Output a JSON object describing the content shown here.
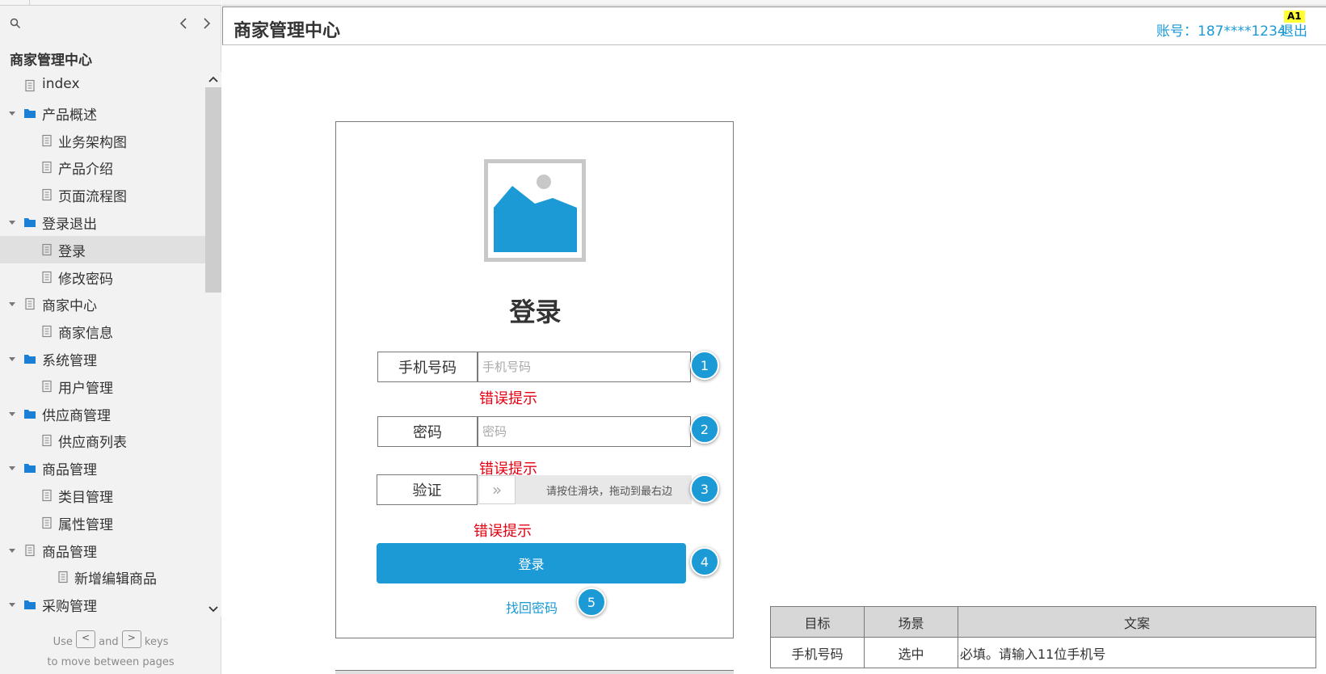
{
  "sidebar": {
    "title": "商家管理中心",
    "items": [
      {
        "label": "index",
        "level": 1,
        "type": "page",
        "caret": false
      },
      {
        "label": "产品概述",
        "level": 0,
        "type": "folder",
        "caret": true
      },
      {
        "label": "业务架构图",
        "level": 2,
        "type": "page",
        "caret": false
      },
      {
        "label": "产品介绍",
        "level": 2,
        "type": "page",
        "caret": false
      },
      {
        "label": "页面流程图",
        "level": 2,
        "type": "page",
        "caret": false
      },
      {
        "label": "登录退出",
        "level": 0,
        "type": "folder",
        "caret": true
      },
      {
        "label": "登录",
        "level": 2,
        "type": "page",
        "caret": false,
        "selected": true
      },
      {
        "label": "修改密码",
        "level": 2,
        "type": "page",
        "caret": false
      },
      {
        "label": "商家中心",
        "level": 0,
        "type": "page",
        "caret": true
      },
      {
        "label": "商家信息",
        "level": 2,
        "type": "page",
        "caret": false
      },
      {
        "label": "系统管理",
        "level": 0,
        "type": "folder",
        "caret": true
      },
      {
        "label": "用户管理",
        "level": 2,
        "type": "page",
        "caret": false
      },
      {
        "label": "供应商管理",
        "level": 0,
        "type": "folder",
        "caret": true
      },
      {
        "label": "供应商列表",
        "level": 2,
        "type": "page",
        "caret": false
      },
      {
        "label": "商品管理",
        "level": 0,
        "type": "folder",
        "caret": true
      },
      {
        "label": "类目管理",
        "level": 2,
        "type": "page",
        "caret": false
      },
      {
        "label": "属性管理",
        "level": 2,
        "type": "page",
        "caret": false
      },
      {
        "label": "商品管理",
        "level": 1,
        "type": "page",
        "caret": true
      },
      {
        "label": "新增编辑商品",
        "level": 3,
        "type": "page",
        "caret": false
      },
      {
        "label": "采购管理",
        "level": 0,
        "type": "folder",
        "caret": true
      }
    ],
    "hint": {
      "use": "Use",
      "and": "and",
      "keys": "keys",
      "line2": "to move between pages",
      "key_prev": "<",
      "key_next": ">"
    }
  },
  "header": {
    "title": "商家管理中心",
    "account": "账号：187****1234",
    "logout": "退出",
    "badge": "A1"
  },
  "login": {
    "title": "登录",
    "phone": {
      "label": "手机号码",
      "placeholder": "手机号码",
      "error": "错误提示"
    },
    "password": {
      "label": "密码",
      "placeholder": "密码",
      "error": "错误提示"
    },
    "verify": {
      "label": "验证",
      "slider_text": "请按住滑块，拖动到最右边",
      "handle": "»",
      "error": "错误提示"
    },
    "submit": "登录",
    "forgot": "找回密码",
    "markers": [
      "1",
      "2",
      "3",
      "4",
      "5"
    ]
  },
  "spec_table": {
    "headers": [
      "目标",
      "场景",
      "文案"
    ],
    "rows": [
      [
        "手机号码",
        "选中",
        "必填。请输入11位手机号"
      ]
    ]
  },
  "colors": {
    "accent": "#1b9ad6",
    "error": "#e60012",
    "badge": "#ffff33"
  }
}
